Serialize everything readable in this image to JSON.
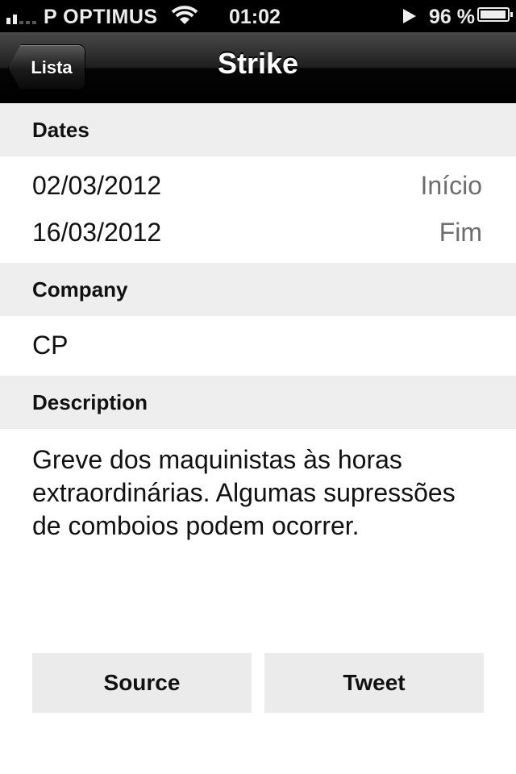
{
  "status_bar": {
    "carrier": "P OPTIMUS",
    "time": "01:02",
    "battery": "96 %",
    "signal_icon": "signal-bars-icon",
    "wifi_icon": "wifi-icon",
    "play_icon": "play-icon",
    "battery_icon": "battery-icon"
  },
  "nav": {
    "back_label": "Lista",
    "title": "Strike"
  },
  "sections": {
    "dates": {
      "header": "Dates",
      "start_date": "02/03/2012",
      "start_label": "Início",
      "end_date": "16/03/2012",
      "end_label": "Fim"
    },
    "company": {
      "header": "Company",
      "value": "CP"
    },
    "description": {
      "header": "Description",
      "text": "Greve dos maquinistas às horas extraordinárias. Algumas supressões de comboios podem ocorrer."
    }
  },
  "buttons": {
    "source_label": "Source",
    "tweet_label": "Tweet"
  },
  "colors": {
    "section_background": "#eeeeee",
    "secondary_text": "#6d6d6d",
    "button_background": "#ebebeb"
  }
}
